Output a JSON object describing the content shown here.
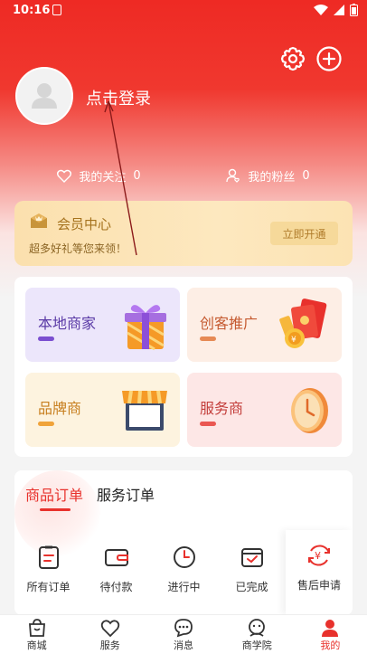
{
  "status_bar": {
    "time": "10:16"
  },
  "profile": {
    "login_label": "点击登录"
  },
  "follow": {
    "following_label": "我的关注",
    "following_count": "0",
    "fans_label": "我的粉丝",
    "fans_count": "0"
  },
  "vip": {
    "title": "会员中心",
    "subtitle": "超多好礼等您来领！",
    "button": "立即开通"
  },
  "categories": [
    {
      "label": "本地商家",
      "color": "#7b4fd0"
    },
    {
      "label": "创客推广",
      "color": "#d8623a"
    },
    {
      "label": "品牌商",
      "color": "#e0862a"
    },
    {
      "label": "服务商",
      "color": "#df4d4a"
    }
  ],
  "orders": {
    "tabs": [
      "商品订单",
      "服务订单"
    ],
    "items": [
      {
        "label": "所有订单",
        "icon": "clipboard-icon"
      },
      {
        "label": "待付款",
        "icon": "wallet-icon"
      },
      {
        "label": "进行中",
        "icon": "clock-icon"
      },
      {
        "label": "已完成",
        "icon": "completed-box-icon"
      },
      {
        "label": "售后申请",
        "icon": "refund-icon"
      }
    ]
  },
  "tabbar": [
    {
      "label": "商城",
      "icon": "shop-bag-icon"
    },
    {
      "label": "服务",
      "icon": "heart-icon"
    },
    {
      "label": "消息",
      "icon": "chat-icon"
    },
    {
      "label": "商学院",
      "icon": "academy-icon"
    },
    {
      "label": "我的",
      "icon": "user-icon",
      "active": true
    }
  ],
  "colors": {
    "brand_red": "#ee2a24",
    "gold": "#a5721d"
  }
}
